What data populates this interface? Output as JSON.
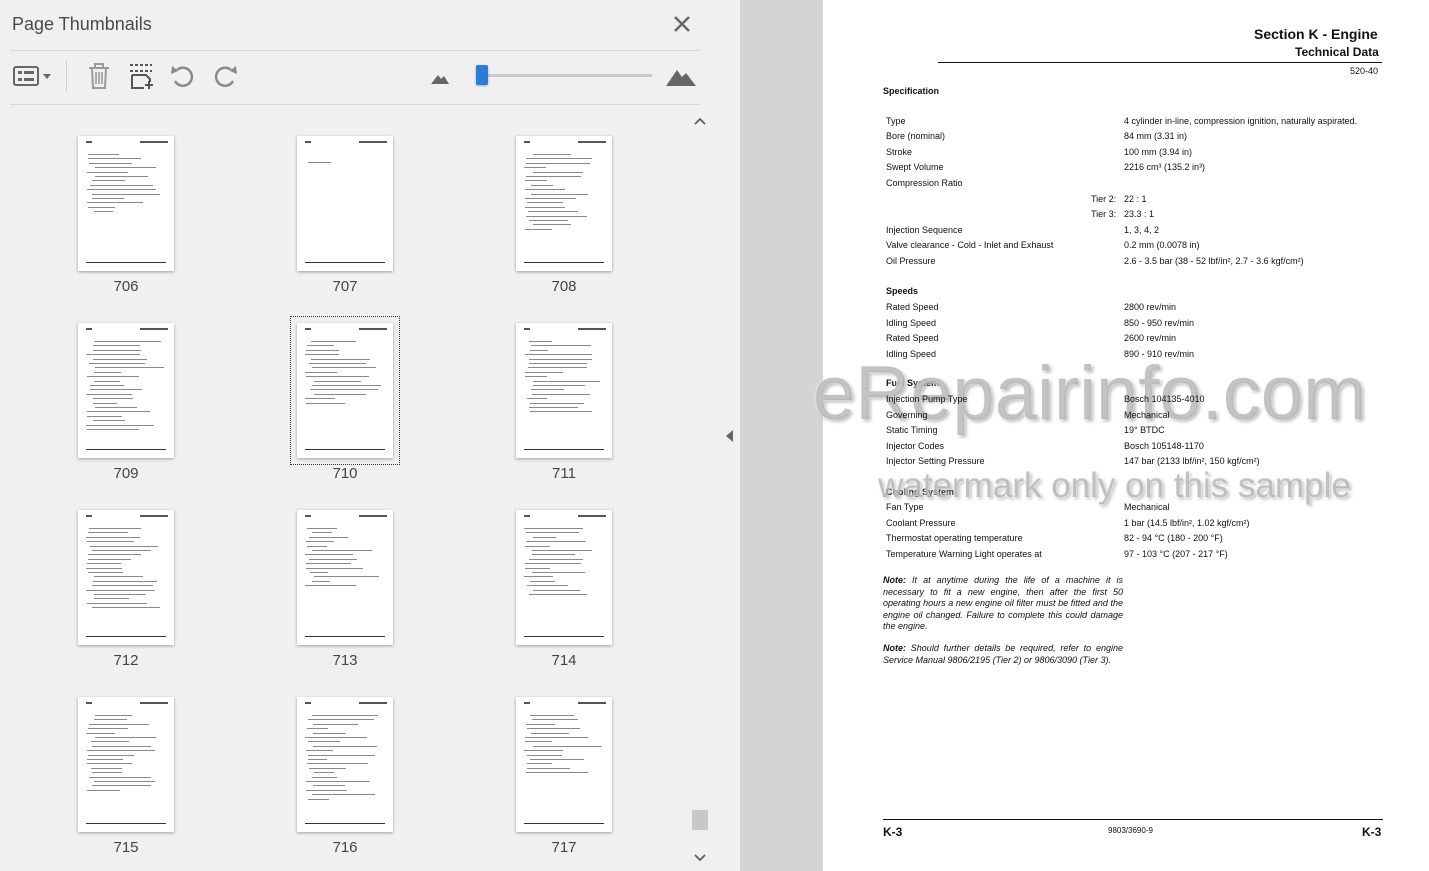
{
  "panel": {
    "title": "Page Thumbnails",
    "close_icon": "close-icon",
    "toolbar": {
      "options_icon": "thumbnail-options-icon",
      "delete_icon": "trash-icon",
      "insert_icon": "insert-pages-icon",
      "rotate_ccw_icon": "rotate-counterclockwise-icon",
      "rotate_cw_icon": "rotate-clockwise-icon",
      "zoom_out_icon": "small-mountain-icon",
      "zoom_in_icon": "large-mountain-icon"
    },
    "zoom_slider_fraction": 0.0,
    "selected_page": "710",
    "thumbnails": [
      {
        "label": "706"
      },
      {
        "label": "707"
      },
      {
        "label": "708"
      },
      {
        "label": "709"
      },
      {
        "label": "710"
      },
      {
        "label": "711"
      },
      {
        "label": "712"
      },
      {
        "label": "713"
      },
      {
        "label": "714"
      },
      {
        "label": "715"
      },
      {
        "label": "716"
      },
      {
        "label": "717"
      }
    ]
  },
  "document": {
    "section_title": "Section K - Engine",
    "subtitle": "Technical Data",
    "ref": "520-40",
    "spec_heading": "Specification",
    "spec_rows": [
      {
        "label": "Type",
        "value": "4 cylinder in-line, compression ignition, naturally aspirated."
      },
      {
        "label": "Bore (nominal)",
        "value": "84 mm (3.31 in)"
      },
      {
        "label": "Stroke",
        "value": "100 mm (3.94 in)"
      },
      {
        "label": "Swept Volume",
        "value": "2216 cm³ (135.2 in³)"
      },
      {
        "label": "Compression Ratio",
        "value": ""
      }
    ],
    "compression": [
      {
        "tier": "Tier 2:",
        "value": "22 : 1"
      },
      {
        "tier": "Tier 3:",
        "value": "23.3 : 1"
      }
    ],
    "spec_rows2": [
      {
        "label": "Injection Sequence",
        "value": "1, 3, 4, 2"
      },
      {
        "label": "Valve clearance - Cold - Inlet and Exhaust",
        "value": "0.2 mm (0.0078 in)"
      },
      {
        "label": "Oil Pressure",
        "value": "2.6 - 3.5 bar (38 - 52 lbf/in², 2.7 - 3.6 kgf/cm²)"
      }
    ],
    "speeds_heading": "Speeds",
    "speeds": [
      {
        "label": "Rated Speed",
        "value": "2800 rev/min"
      },
      {
        "label": "Idling Speed",
        "value": "850 - 950 rev/min"
      },
      {
        "label": "Rated Speed",
        "value": "2600 rev/min"
      },
      {
        "label": "Idling Speed",
        "value": "890 - 910 rev/min"
      }
    ],
    "fuel_heading": "Fuel System",
    "fuel": [
      {
        "label": "Injection Pump Type",
        "value": "Bosch 104135-4010"
      },
      {
        "label": "Governing",
        "value": "Mechanical"
      },
      {
        "label": "Static Timing",
        "value": "19° BTDC"
      },
      {
        "label": "Injector Codes",
        "value": "Bosch 105148-1170"
      },
      {
        "label": "Injector Setting Pressure",
        "value": "147 bar (2133 lbf/in², 150 kgf/cm²)"
      }
    ],
    "cooling_heading": "Cooling System",
    "cooling": [
      {
        "label": "Fan Type",
        "value": "Mechanical"
      },
      {
        "label": "Coolant Pressure",
        "value": "1 bar (14.5 lbf/in², 1.02 kgf/cm²)"
      },
      {
        "label": "Thermostat operating temperature",
        "value": "82 - 94 °C (180 - 200 °F)"
      },
      {
        "label": "Temperature Warning Light operates at",
        "value": "97 - 103 °C (207 - 217 °F)"
      }
    ],
    "note1_label": "Note:",
    "note1_text": " It at anytime during the life of a machine it is necessary to fit a new engine, then after the first 50 operating hours a new engine oil filter must be fitted and the engine oil changed. Failure to complete this could damage the engine.",
    "note2_label": "Note:",
    "note2_text": " Should further details be required, refer to engine Service Manual 9806/2195 (Tier 2) or 9806/3090 (Tier 3).",
    "footer_left": "K-3",
    "footer_center": "9803/3690-9",
    "footer_right": "K-3",
    "watermark_main": "eRepairinfo.com",
    "watermark_sub": "watermark only on this sample"
  },
  "viewer": {
    "collapse_icon": "collapse-left-icon"
  }
}
